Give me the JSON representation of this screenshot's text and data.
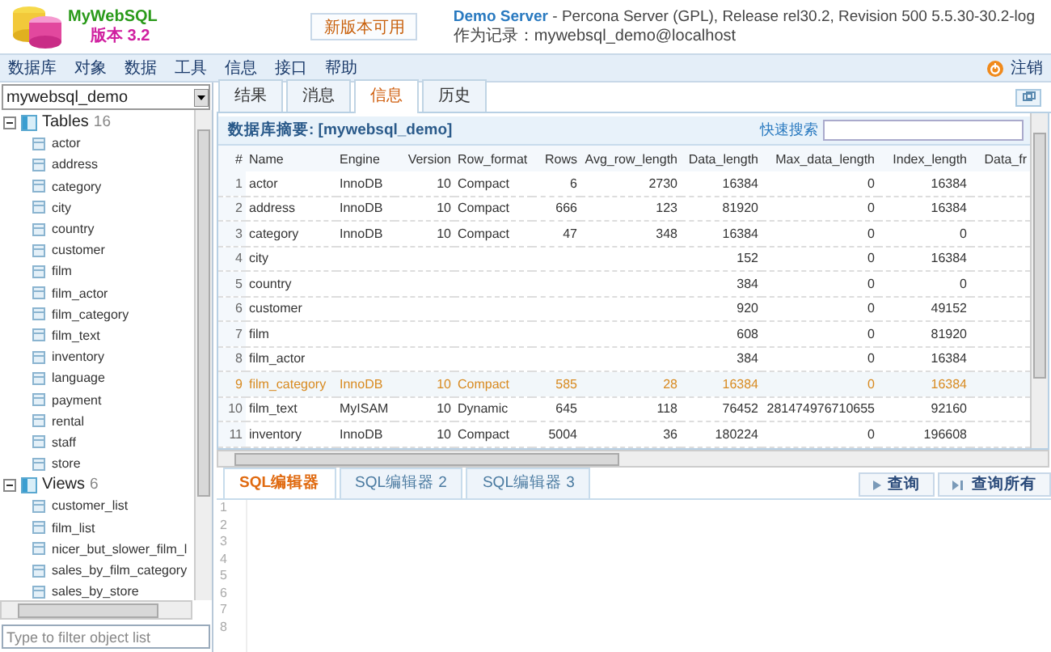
{
  "app": {
    "name": "MyWebSQL",
    "version": "版本 3.2"
  },
  "update_button": "新版本可用",
  "server": {
    "name": "Demo Server",
    "details": " - Percona Server (GPL), Release rel30.2, Revision 500 5.5.30-30.2-log",
    "login": "作为记录：mywebsql_demo@localhost"
  },
  "menu": [
    "数据库",
    "对象",
    "数据",
    "工具",
    "信息",
    "接口",
    "帮助"
  ],
  "logout": "注销",
  "database_select": "mywebsql_demo",
  "tree": [
    {
      "label": "Tables",
      "count": "16",
      "expanded": true,
      "children": [
        "actor",
        "address",
        "category",
        "city",
        "country",
        "customer",
        "film",
        "film_actor",
        "film_category",
        "film_text",
        "inventory",
        "language",
        "payment",
        "rental",
        "staff",
        "store"
      ]
    },
    {
      "label": "Views",
      "count": "6",
      "expanded": true,
      "children": [
        "customer_list",
        "film_list",
        "nicer_but_slower_film_l",
        "sales_by_film_category",
        "sales_by_store"
      ]
    }
  ],
  "filter": {
    "placeholder": "Type to filter object list"
  },
  "result_tabs": [
    {
      "label": "结果",
      "selected": false
    },
    {
      "label": "消息",
      "selected": false
    },
    {
      "label": "信息",
      "selected": true
    },
    {
      "label": "历史",
      "selected": false
    }
  ],
  "summary": {
    "title": "数据库摘要: [mywebsql_demo]",
    "search_label": "快速搜索"
  },
  "table": {
    "columns": [
      "#",
      "Name",
      "Engine",
      "Version",
      "Row_format",
      "Rows",
      "Avg_row_length",
      "Data_length",
      "Max_data_length",
      "Index_length",
      "Data_fr"
    ],
    "rows": [
      {
        "cells": [
          "1",
          "actor",
          "InnoDB",
          "10",
          "Compact",
          "6",
          "2730",
          "16384",
          "0",
          "16384"
        ],
        "selected": false
      },
      {
        "cells": [
          "2",
          "address",
          "InnoDB",
          "10",
          "Compact",
          "666",
          "123",
          "81920",
          "0",
          "16384"
        ],
        "selected": false
      },
      {
        "cells": [
          "3",
          "category",
          "InnoDB",
          "10",
          "Compact",
          "47",
          "348",
          "16384",
          "0",
          "0"
        ],
        "selected": false
      },
      {
        "cells": [
          "4",
          "city",
          "",
          "",
          "",
          "",
          "",
          "152",
          "0",
          "16384"
        ],
        "selected": false
      },
      {
        "cells": [
          "5",
          "country",
          "",
          "",
          "",
          "",
          "",
          "384",
          "0",
          "0"
        ],
        "selected": false
      },
      {
        "cells": [
          "6",
          "customer",
          "",
          "",
          "",
          "",
          "",
          "920",
          "0",
          "49152"
        ],
        "selected": false
      },
      {
        "cells": [
          "7",
          "film",
          "",
          "",
          "",
          "",
          "",
          "608",
          "0",
          "81920"
        ],
        "selected": false
      },
      {
        "cells": [
          "8",
          "film_actor",
          "",
          "",
          "",
          "",
          "",
          "384",
          "0",
          "16384"
        ],
        "selected": false
      },
      {
        "cells": [
          "9",
          "film_category",
          "InnoDB",
          "10",
          "Compact",
          "585",
          "28",
          "16384",
          "0",
          "16384"
        ],
        "selected": true
      },
      {
        "cells": [
          "10",
          "film_text",
          "MyISAM",
          "10",
          "Dynamic",
          "645",
          "118",
          "76452",
          "281474976710655",
          "92160"
        ],
        "selected": false
      },
      {
        "cells": [
          "11",
          "inventory",
          "InnoDB",
          "10",
          "Compact",
          "5004",
          "36",
          "180224",
          "0",
          "196608"
        ],
        "selected": false
      }
    ]
  },
  "editor_tabs": [
    {
      "label": "SQL编辑器",
      "selected": true
    },
    {
      "label": "SQL编辑器 2",
      "selected": false
    },
    {
      "label": "SQL编辑器 3",
      "selected": false
    }
  ],
  "editor_buttons": [
    {
      "label": "查询",
      "kind": "single"
    },
    {
      "label": "查询所有",
      "kind": "all"
    }
  ],
  "line_numbers": [
    "1",
    "2",
    "3",
    "4",
    "5",
    "6",
    "7",
    "8"
  ]
}
